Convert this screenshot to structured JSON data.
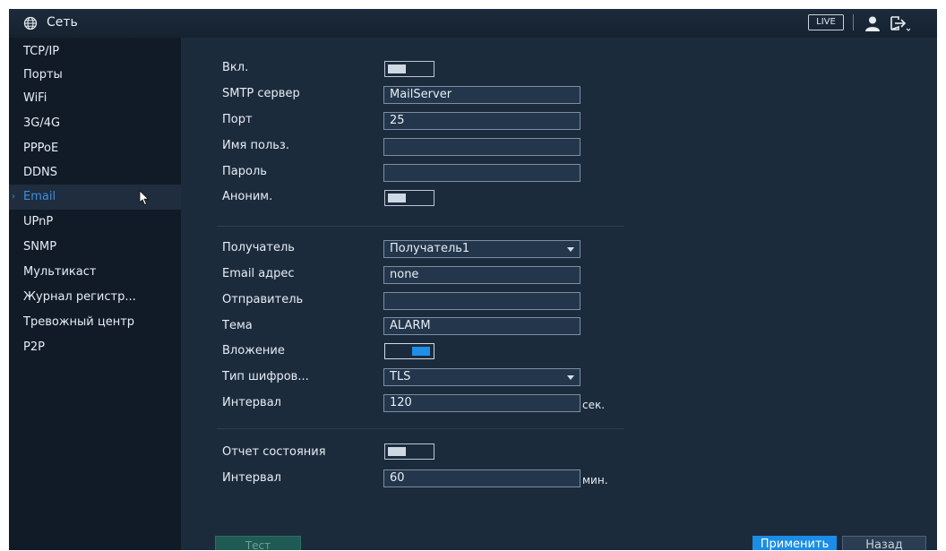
{
  "header": {
    "title": "Сеть",
    "live_label": "LIVE",
    "icons": {
      "globe": "globe-icon",
      "user": "user-icon",
      "logout": "logout-icon"
    }
  },
  "sidebar": {
    "items": [
      {
        "label": "TCP/IP"
      },
      {
        "label": "Порты"
      },
      {
        "label": "WiFi"
      },
      {
        "label": "3G/4G"
      },
      {
        "label": "PPPoE"
      },
      {
        "label": "DDNS"
      },
      {
        "label": "Email",
        "active": true
      },
      {
        "label": "UPnP"
      },
      {
        "label": "SNMP"
      },
      {
        "label": "Мультикаст"
      },
      {
        "label": "Журнал регистр..."
      },
      {
        "label": "Тревожный центр"
      },
      {
        "label": "P2P"
      }
    ]
  },
  "form": {
    "enable_label": "Вкл.",
    "smtp_label": "SMTP сервер",
    "smtp_value": "MailServer",
    "port_label": "Порт",
    "port_value": "25",
    "username_label": "Имя польз.",
    "username_value": "",
    "password_label": "Пароль",
    "password_value": "",
    "anon_label": "Аноним.",
    "recipient_label": "Получатель",
    "recipient_value": "Получатель1",
    "email_label": "Email адрес",
    "email_value": "none",
    "sender_label": "Отправитель",
    "sender_value": "",
    "subject_label": "Тема",
    "subject_value": "ALARM",
    "attach_label": "Вложение",
    "encryption_label": "Тип шифров...",
    "encryption_value": "TLS",
    "interval_label": "Интервал",
    "interval_value": "120",
    "interval_unit": "сек.",
    "status_report_label": "Отчет состояния",
    "status_interval_label": "Интервал",
    "status_interval_value": "60",
    "status_interval_unit": "мин."
  },
  "toggles": {
    "enable": false,
    "anonymous": false,
    "attachment": true,
    "status_report": false
  },
  "buttons": {
    "test": "Тест",
    "apply": "Применить",
    "back": "Назад"
  },
  "colors": {
    "accent": "#1b8de6",
    "active_text": "#3c8fe0",
    "background": "#1c2b3c"
  }
}
